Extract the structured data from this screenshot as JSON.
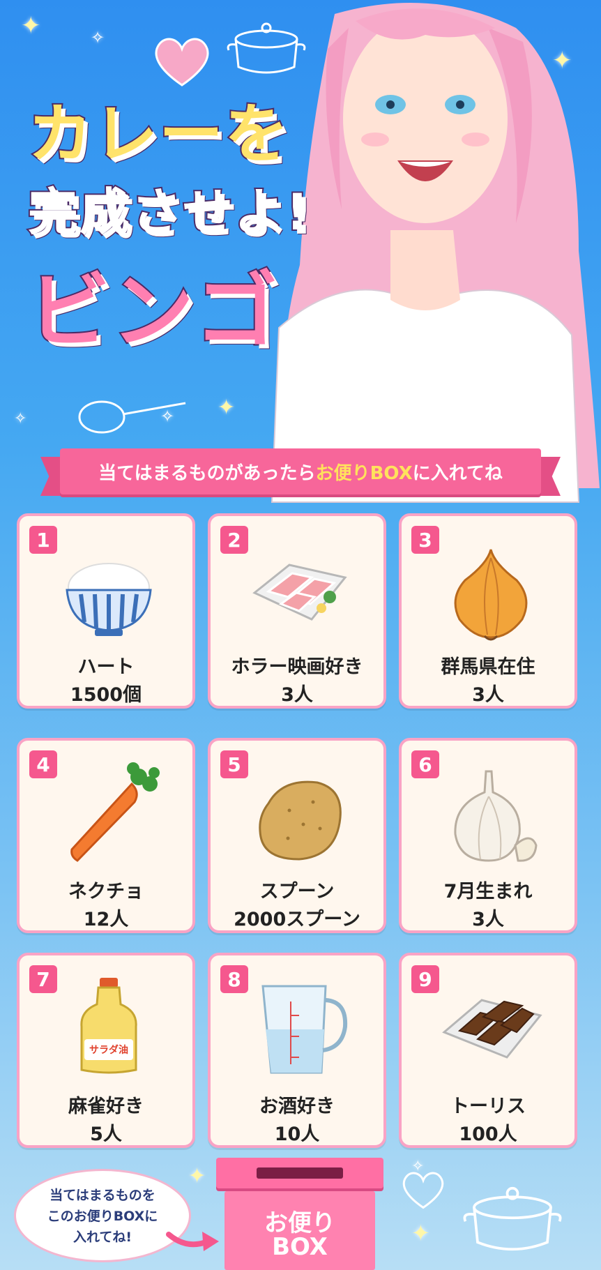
{
  "title": {
    "line1": "カレーを",
    "line2": "完成させよ!",
    "line3": "ビンゴ"
  },
  "banner": {
    "prefix": "当てはまるものがあったら",
    "highlight": "お便りBOX",
    "suffix": "に入れてね"
  },
  "cells": [
    {
      "number": "1",
      "label": "ハート",
      "count": "1500個",
      "icon": "rice-bowl-icon"
    },
    {
      "number": "2",
      "label": "ホラー映画好き",
      "count": "3人",
      "icon": "meat-tray-icon"
    },
    {
      "number": "3",
      "label": "群馬県在住",
      "count": "3人",
      "icon": "onion-icon"
    },
    {
      "number": "4",
      "label": "ネクチョ",
      "count": "12人",
      "icon": "carrot-icon"
    },
    {
      "number": "5",
      "label": "スプーン",
      "count": "2000スプーン",
      "icon": "potato-icon"
    },
    {
      "number": "6",
      "label": "7月生まれ",
      "count": "3人",
      "icon": "garlic-icon"
    },
    {
      "number": "7",
      "label": "麻雀好き",
      "count": "5人",
      "icon": "oil-bottle-icon"
    },
    {
      "number": "8",
      "label": "お酒好き",
      "count": "10人",
      "icon": "measuring-cup-icon"
    },
    {
      "number": "9",
      "label": "トーリス",
      "count": "100人",
      "icon": "curry-roux-icon"
    }
  ],
  "oil_label": "サラダ油",
  "bubble": {
    "line1": "当てはまるものを",
    "line2": "このお便りBOXに",
    "line3": "入れてね!"
  },
  "box": {
    "line1": "お便り",
    "line2": "BOX"
  },
  "colors": {
    "accent_pink": "#f5588e",
    "title_yellow": "#ffe36b",
    "title_pink": "#ff7fb1",
    "highlight_yellow": "#ffe25c",
    "background_blue": "#2f8ff0"
  }
}
